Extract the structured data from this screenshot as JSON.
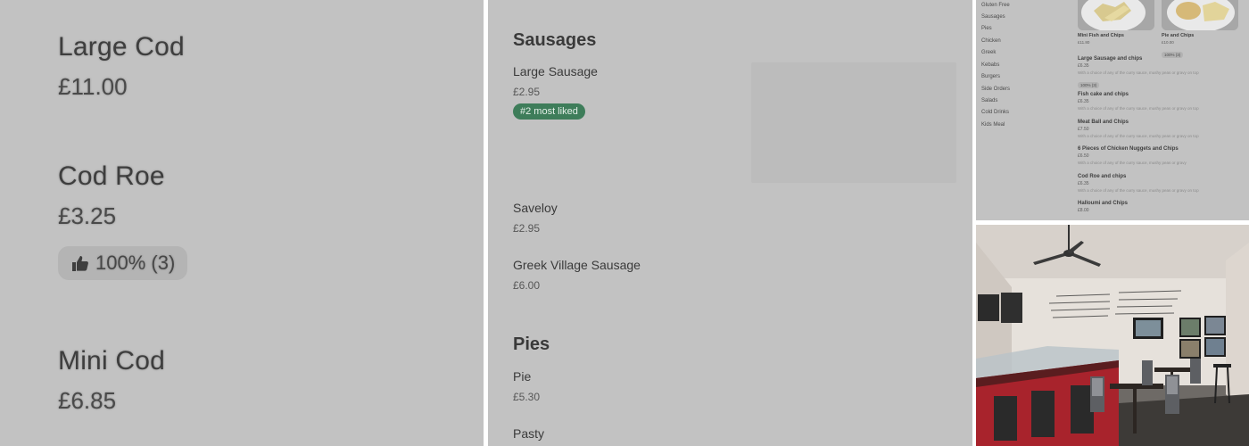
{
  "panel_zoom": {
    "items": [
      {
        "name": "Large Cod",
        "price": "£11.00"
      },
      {
        "name": "Cod Roe",
        "price": "£3.25",
        "rating": "100% (3)"
      },
      {
        "name": "Mini Cod",
        "price": "£6.85"
      }
    ]
  },
  "panel_menu": {
    "sections": [
      {
        "title": "Sausages"
      },
      {
        "title": "Pies"
      }
    ],
    "sausages": [
      {
        "name": "Large Sausage",
        "price": "£2.95",
        "badge": "#2 most liked"
      },
      {
        "name": "Saveloy",
        "price": "£2.95"
      },
      {
        "name": "Greek Village Sausage",
        "price": "£6.00"
      }
    ],
    "pies": [
      {
        "name": "Pie",
        "price": "£5.30"
      },
      {
        "name": "Pasty",
        "price": ""
      }
    ]
  },
  "panel_small": {
    "categories": [
      "Gluten Free",
      "Sausages",
      "Pies",
      "Chicken",
      "Greek",
      "Kebabs",
      "Burgers",
      "Side Orders",
      "Salads",
      "Cold Drinks",
      "Kids Meal"
    ],
    "cards": [
      {
        "title": "Mini Fish and Chips",
        "price": "£11.80"
      },
      {
        "title": "Pie and Chips",
        "price": "£10.00",
        "rating": "100% (3)"
      }
    ],
    "items": [
      {
        "name": "Large Sausage and chips",
        "price": "£6.35",
        "desc": "With a choice of any of the curry sauce, mushy peas or gravy on top",
        "rating": "100% (3)"
      },
      {
        "name": "Fish cake and chips",
        "price": "£6.35",
        "desc": "With a choice of any of the curry sauce, mushy peas or gravy on top"
      },
      {
        "name": "Meat Ball and Chips",
        "price": "£7.50",
        "desc": "With a choice of any of the curry sauce, mushy peas or gravy on top"
      },
      {
        "name": "6 Pieces of Chicken Nuggets and Chips",
        "price": "£6.50",
        "desc": "With a choice of any of the curry sauce, mushy peas or gravy"
      },
      {
        "name": "Cod Roe and chips",
        "price": "£6.35",
        "desc": "With a choice of any of the curry sauce, mushy peas or gravy on top"
      },
      {
        "name": "Halloumi and Chips",
        "price": "£8.00"
      }
    ]
  },
  "colors": {
    "panel_bg": "#c2c2c2",
    "badge_green": "#3e7d5a",
    "counter_red": "#a8232c"
  }
}
